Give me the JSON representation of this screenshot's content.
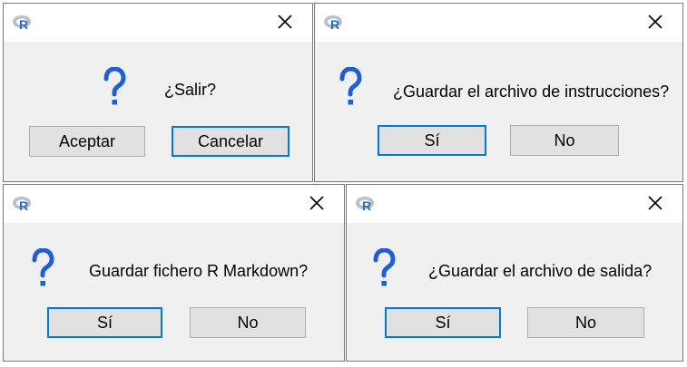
{
  "dialogs": [
    {
      "id": "salir",
      "message": "¿Salir?",
      "buttons": [
        {
          "label": "Aceptar",
          "default": false
        },
        {
          "label": "Cancelar",
          "default": true
        }
      ]
    },
    {
      "id": "guardar-instrucciones",
      "message": "¿Guardar el archivo de instrucciones?",
      "buttons": [
        {
          "label": "Sí",
          "default": true
        },
        {
          "label": "No",
          "default": false
        }
      ]
    },
    {
      "id": "guardar-markdown",
      "message": "Guardar fichero R Markdown?",
      "buttons": [
        {
          "label": "Sí",
          "default": true
        },
        {
          "label": "No",
          "default": false
        }
      ]
    },
    {
      "id": "guardar-salida",
      "message": "¿Guardar el archivo de salida?",
      "buttons": [
        {
          "label": "Sí",
          "default": true
        },
        {
          "label": "No",
          "default": false
        }
      ]
    }
  ],
  "icons": {
    "app": "r-logo-icon",
    "close": "close-icon",
    "question": "question-icon"
  },
  "colors": {
    "dialog_bg": "#f0f0f0",
    "titlebar_bg": "#ffffff",
    "button_bg": "#e1e1e1",
    "button_border": "#adadad",
    "default_button_border": "#0078d7",
    "question_blue": "#1f5fd6"
  }
}
